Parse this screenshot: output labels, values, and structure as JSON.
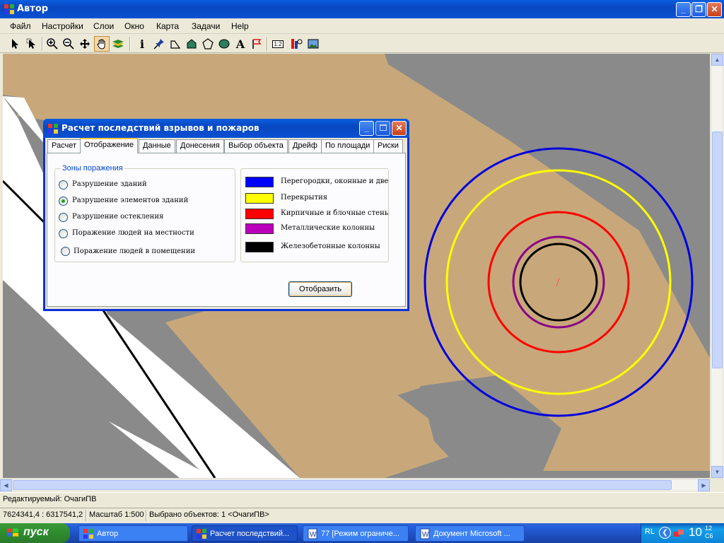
{
  "window": {
    "title": "Автор",
    "minimize": "_",
    "maximize": "❐",
    "close": "✕"
  },
  "menu": [
    "Файл",
    "Настройки",
    "Слои",
    "Окно",
    "Карта",
    "Задачи",
    "Help"
  ],
  "toolbar": {
    "tools": [
      "select-arrow-icon",
      "select-region-icon",
      "zoom-in-icon",
      "zoom-out-icon",
      "pan-move-icon",
      "hand-pan-icon",
      "layers-icon",
      "info-icon",
      "pin-icon",
      "polyline-icon",
      "house-polygon-icon",
      "polygon-icon",
      "ellipse-icon",
      "text-icon",
      "flag-icon",
      "ruler-icon",
      "settings-icon",
      "image-icon"
    ],
    "pressed": "hand-pan-icon",
    "text_tool_glyph": "A",
    "info_glyph": "i",
    "ruler_glyph": "1:2"
  },
  "dialog": {
    "title": "Расчет последствий взрывов и пожаров",
    "tabs": [
      "Расчет",
      "Отображение",
      "Данные",
      "Донесения",
      "Выбор объекта",
      "Дрейф",
      "По площади",
      "Риски"
    ],
    "active_tab": "Отображение",
    "zones_legend": "Зоны поражения",
    "zones": [
      {
        "label": "Разрушение зданий",
        "checked": false
      },
      {
        "label": "Разрушение элементов зданий",
        "checked": true
      },
      {
        "label": "Разрушение остекления",
        "checked": false
      },
      {
        "label": "Поражение людей на местности",
        "checked": false
      },
      {
        "label": "Поражение людей в помещении",
        "checked": false
      }
    ],
    "color_legend": [
      {
        "label": "Перегородки, оконные и дверные",
        "color": "#0000FF"
      },
      {
        "label": "Перекрытия",
        "color": "#FFFF00"
      },
      {
        "label": "Кирпичные и блочные стены",
        "color": "#FF0000"
      },
      {
        "label": "Металлические колонны",
        "color": "#BB00BB"
      },
      {
        "label": "Железобетонные колонны",
        "color": "#000000"
      }
    ],
    "show_button": "Отобразить"
  },
  "map": {
    "ring_colors": [
      "#0000DD",
      "#FFFF00",
      "#FF0000",
      "#880088",
      "#000000"
    ],
    "fill_building": "#C8A87A",
    "background": "#8A8A8A"
  },
  "status": {
    "editing": "Редактируемый: ОчагиПВ",
    "coords": "7624341,4 : 6317541,2",
    "scale": "Масштаб 1:500",
    "selected": "Выбрано объектов: 1 <ОчагиПВ>"
  },
  "taskbar": {
    "start": "пуск",
    "tasks": [
      {
        "label": "Автор",
        "active": false
      },
      {
        "label": "Расчет последствий...",
        "active": true
      },
      {
        "label": "77 [Режим ограниче...",
        "active": false
      },
      {
        "label": "Документ Microsoft ...",
        "active": false
      }
    ],
    "lang": "RL",
    "time": "10",
    "time_small_top": "12",
    "time_small_bottom": "С6"
  }
}
